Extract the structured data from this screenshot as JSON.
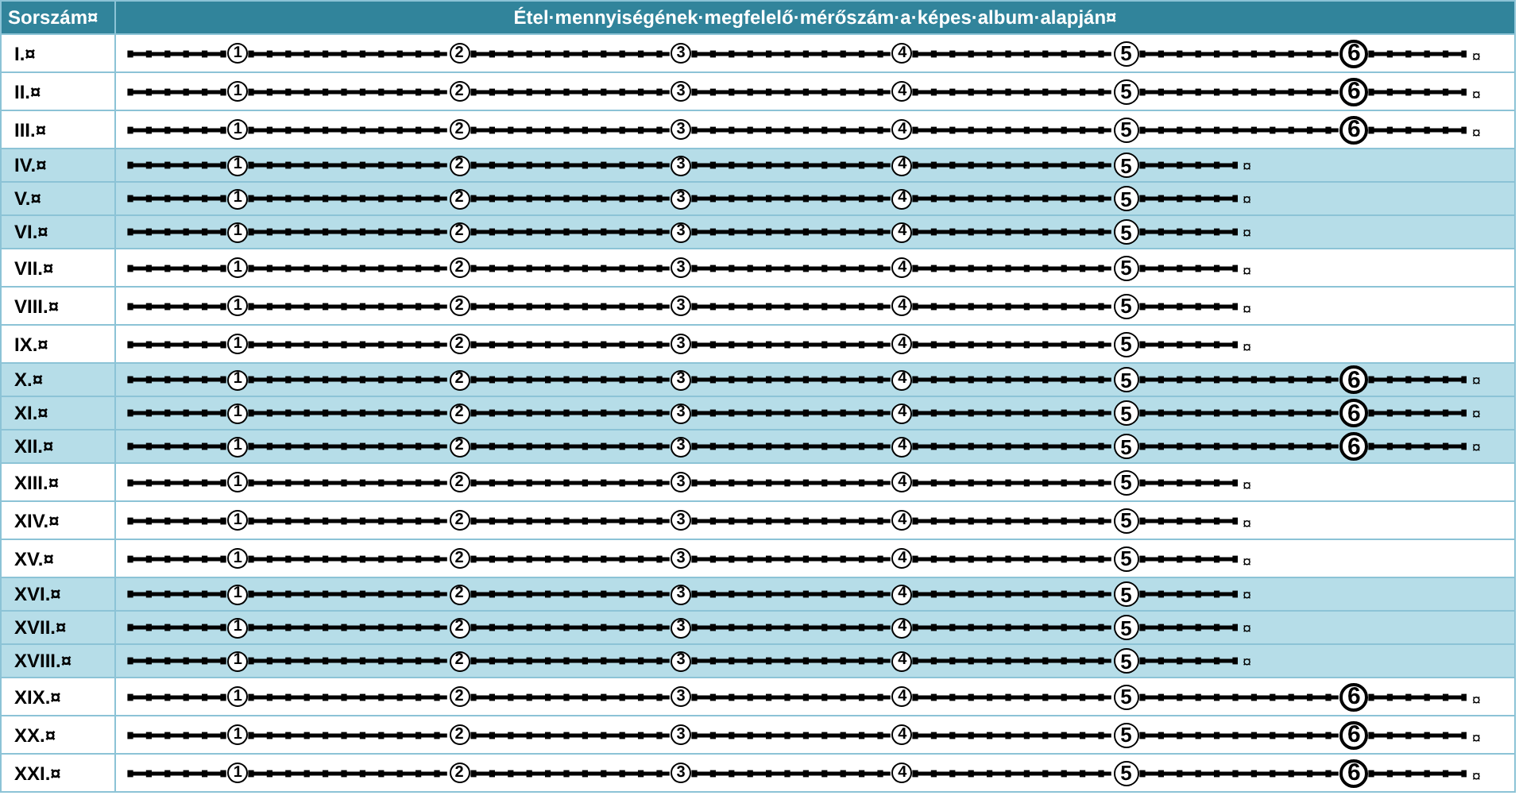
{
  "header": {
    "number_column": "Sorszám¤",
    "scale_column": "Étel·mennyiségének·megfelelő·mérőszám·a·képes·album·alapján¤"
  },
  "rows": [
    {
      "label": "I.¤",
      "highlighted": false,
      "markers": [
        "1",
        "2",
        "3",
        "4",
        "5",
        "6"
      ],
      "end_mark": "¤"
    },
    {
      "label": "II.¤",
      "highlighted": false,
      "markers": [
        "1",
        "2",
        "3",
        "4",
        "5",
        "6"
      ],
      "end_mark": "¤"
    },
    {
      "label": "III.¤",
      "highlighted": false,
      "markers": [
        "1",
        "2",
        "3",
        "4",
        "5",
        "6"
      ],
      "end_mark": "¤"
    },
    {
      "label": "IV.¤",
      "highlighted": true,
      "markers": [
        "1",
        "2",
        "3",
        "4",
        "5"
      ],
      "end_mark": "¤"
    },
    {
      "label": "V.¤",
      "highlighted": true,
      "markers": [
        "1",
        "2",
        "3",
        "4",
        "5"
      ],
      "end_mark": "¤"
    },
    {
      "label": "VI.¤",
      "highlighted": true,
      "markers": [
        "1",
        "2",
        "3",
        "4",
        "5"
      ],
      "end_mark": "¤"
    },
    {
      "label": "VII.¤",
      "highlighted": false,
      "markers": [
        "1",
        "2",
        "3",
        "4",
        "5"
      ],
      "end_mark": "¤"
    },
    {
      "label": "VIII.¤",
      "highlighted": false,
      "markers": [
        "1",
        "2",
        "3",
        "4",
        "5"
      ],
      "end_mark": "¤"
    },
    {
      "label": "IX.¤",
      "highlighted": false,
      "markers": [
        "1",
        "2",
        "3",
        "4",
        "5"
      ],
      "end_mark": "¤"
    },
    {
      "label": "X.¤",
      "highlighted": true,
      "markers": [
        "1",
        "2",
        "3",
        "4",
        "5",
        "6"
      ],
      "end_mark": "¤"
    },
    {
      "label": "XI.¤",
      "highlighted": true,
      "markers": [
        "1",
        "2",
        "3",
        "4",
        "5",
        "6"
      ],
      "end_mark": "¤"
    },
    {
      "label": "XII.¤",
      "highlighted": true,
      "markers": [
        "1",
        "2",
        "3",
        "4",
        "5",
        "6"
      ],
      "end_mark": "¤"
    },
    {
      "label": "XIII.¤",
      "highlighted": false,
      "markers": [
        "1",
        "2",
        "3",
        "4",
        "5"
      ],
      "end_mark": "¤"
    },
    {
      "label": "XIV.¤",
      "highlighted": false,
      "markers": [
        "1",
        "2",
        "3",
        "4",
        "5"
      ],
      "end_mark": "¤"
    },
    {
      "label": "XV.¤",
      "highlighted": false,
      "markers": [
        "1",
        "2",
        "3",
        "4",
        "5"
      ],
      "end_mark": "¤"
    },
    {
      "label": "XVI.¤",
      "highlighted": true,
      "markers": [
        "1",
        "2",
        "3",
        "4",
        "5"
      ],
      "end_mark": "¤"
    },
    {
      "label": "XVII.¤",
      "highlighted": true,
      "markers": [
        "1",
        "2",
        "3",
        "4",
        "5"
      ],
      "end_mark": "¤"
    },
    {
      "label": "XVIII.¤",
      "highlighted": true,
      "markers": [
        "1",
        "2",
        "3",
        "4",
        "5"
      ],
      "end_mark": "¤"
    },
    {
      "label": "XIX.¤",
      "highlighted": false,
      "markers": [
        "1",
        "2",
        "3",
        "4",
        "5",
        "6"
      ],
      "end_mark": "¤"
    },
    {
      "label": "XX.¤",
      "highlighted": false,
      "markers": [
        "1",
        "2",
        "3",
        "4",
        "5",
        "6"
      ],
      "end_mark": "¤"
    },
    {
      "label": "XXI.¤",
      "highlighted": false,
      "markers": [
        "1",
        "2",
        "3",
        "4",
        "5",
        "6"
      ],
      "end_mark": "¤"
    }
  ]
}
